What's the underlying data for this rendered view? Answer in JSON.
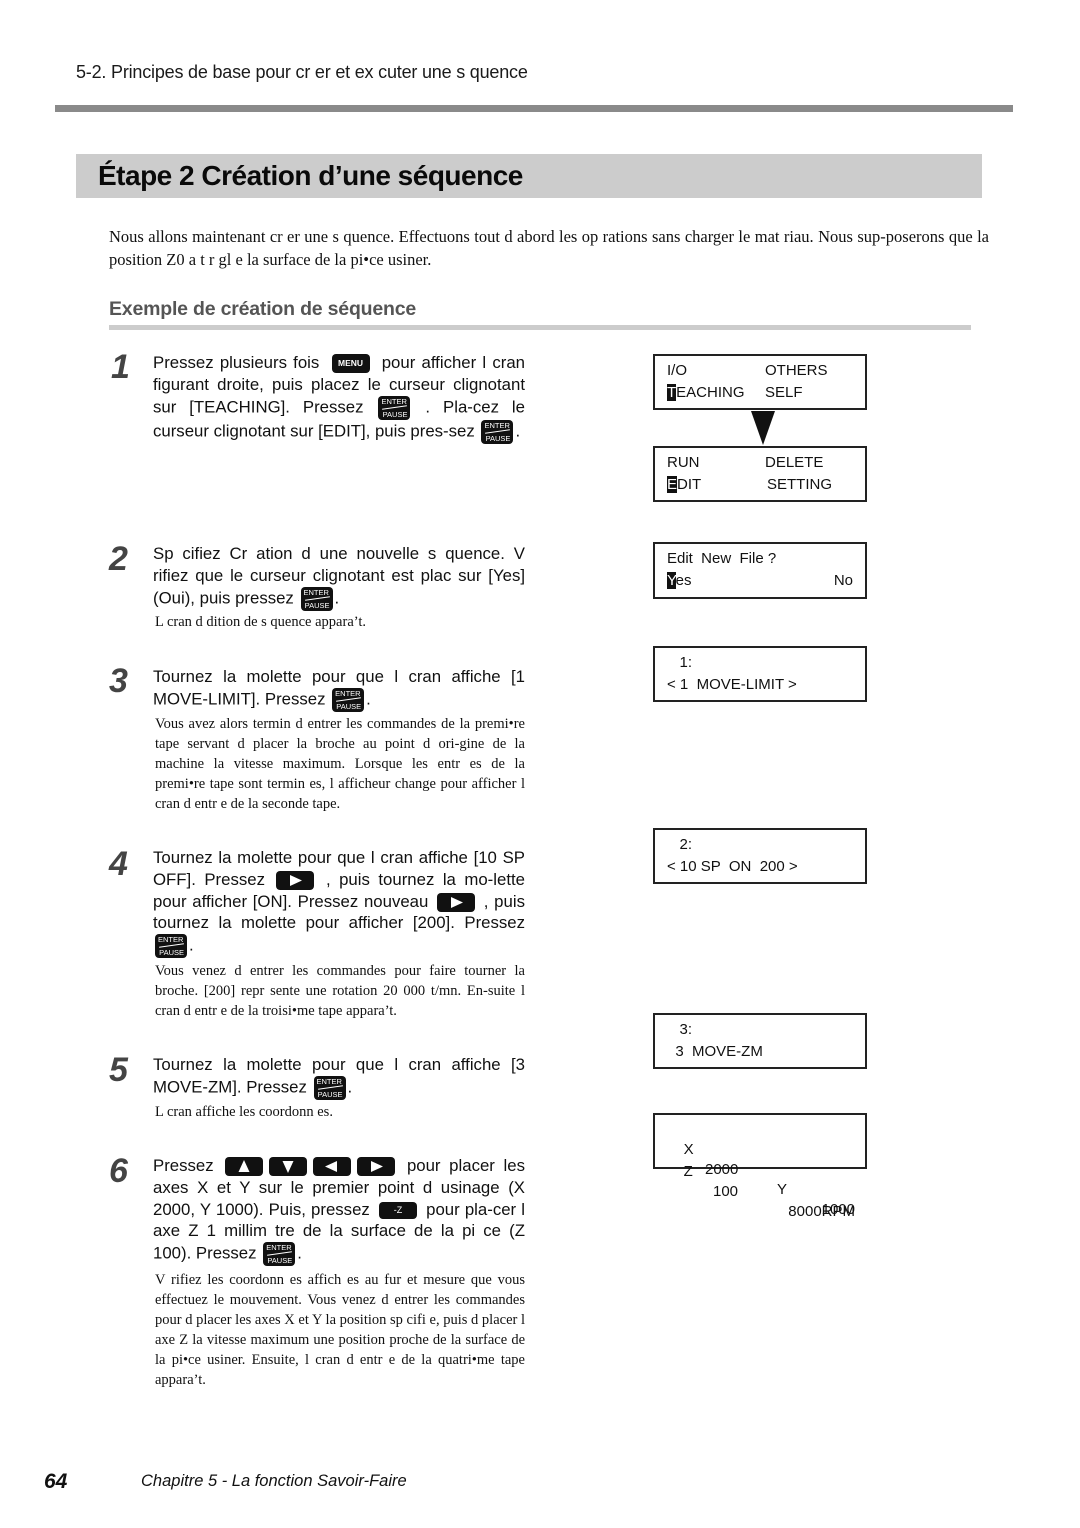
{
  "header": {
    "running_head": "5-2. Principes de base pour cr  er et ex  cuter une s  quence"
  },
  "title": "Étape 2  Création d’une séquence",
  "intro": "Nous allons maintenant cr  er une s  quence. Effectuons tout d  abord les op  rations sans charger le mat  riau. Nous sup-poserons que la position Z0 a   t   r  gl  e    la surface de la pi•ce    usiner.",
  "subheading": "Exemple de création de séquence",
  "keys": {
    "menu": "MENU",
    "enter_top": "ENTER",
    "enter_bottom": "PAUSE",
    "minus_z": "-Z"
  },
  "steps": [
    {
      "number": "1",
      "parts": [
        "Pressez plusieurs fois",
        "pour afficher l   cran figurant    droite, puis placez le curseur clignotant sur [TEACHING]. Pressez",
        ". Pla-cez le curseur clignotant sur [EDIT], puis pres-sez",
        "."
      ],
      "note": ""
    },
    {
      "number": "2",
      "parts": [
        "Sp  cifiez Cr  ation d une nouvelle s  quence. V  rifiez que le curseur clignotant est plac    sur [Yes] (Oui), puis pressez",
        "."
      ],
      "note": "L   cran d   dition de s  quence appara’t."
    },
    {
      "number": "3",
      "parts": [
        "Tournez la molette pour que l   cran affiche [1 MOVE-LIMIT]. Pressez",
        "."
      ],
      "note": "Vous avez alors termin   d entrer les commandes de la premi•re   tape servant   d  placer la broche au point d ori-gine de la machine    la vitesse maximum. Lorsque les entr  es de la premi•re   tape sont termin  es, l afficheur change pour afficher l   cran d  entr  e de la seconde   tape."
    },
    {
      "number": "4",
      "parts": [
        "Tournez la molette pour que l   cran affiche [10 SP OFF]. Pressez",
        ", puis tournez la mo-lette pour afficher [ON]. Pressez    nouveau",
        ", puis tournez la molette pour afficher [200]. Pressez",
        "."
      ],
      "note": "Vous venez d entrer les commandes pour faire tourner la broche. [200] repr  sente une rotation    20 000 t/mn. En-suite l   cran d  entr  e de la troisi•me   tape appara’t."
    },
    {
      "number": "5",
      "parts": [
        "Tournez la molette pour que l   cran affiche [3 MOVE-ZM]. Pressez",
        "."
      ],
      "note": "L   cran affiche les coordonn  es."
    },
    {
      "number": "6",
      "parts": [
        "Pressez",
        "pour placer les axes X et Y sur le premier point d usinage (X 2000, Y 1000). Puis, pressez",
        "pour pla-cer l axe Z    1 millim  tre de la surface de la pi  ce (Z 100). Pressez",
        "."
      ],
      "note": "V  rifiez les coordonn  es affich  es au fur et    mesure que vous effectuez le mouvement. Vous venez d entrer les commandes pour d  placer les axes X et Y    la position sp  cifi  e, puis d  placer l axe Z    la vitesse maximum    une position proche de la surface de la pi•ce    usiner. Ensuite, l   cran d  entr  e de la quatri•me   tape appara’t."
    }
  ],
  "lcd_screens": [
    {
      "row1_left": "I/O",
      "row1_right": "OTHERS",
      "row2_cursor": "T",
      "row2_left": "EACHING",
      "row2_right": "SELF"
    },
    {
      "row1_left": "RUN",
      "row1_right": "DELETE",
      "row2_cursor": "E",
      "row2_left": "DIT",
      "row2_right": "SETTING"
    },
    {
      "row1_left": "Edit  New  File ?",
      "row2_cursor": "Y",
      "row2_left": "es",
      "row2_right": "No"
    },
    {
      "row1_left": "   1:",
      "row2_left": "< 1  MOVE-LIMIT >"
    },
    {
      "row1_left": "   2:",
      "row2_left": "< 10 SP  ON  200 >"
    },
    {
      "row1_left": "   3:",
      "row2_left": "  3  MOVE-ZM"
    },
    {
      "row1_x": "X",
      "row1_xval": "2000",
      "row1_y": "Y",
      "row1_yval": "1000",
      "row2_z": "Z",
      "row2_zval": "100",
      "row2_rpm": "8000RPM"
    }
  ],
  "footer": {
    "page_number": "64",
    "chapter": "Chapitre 5 - La fonction Savoir-Faire"
  }
}
